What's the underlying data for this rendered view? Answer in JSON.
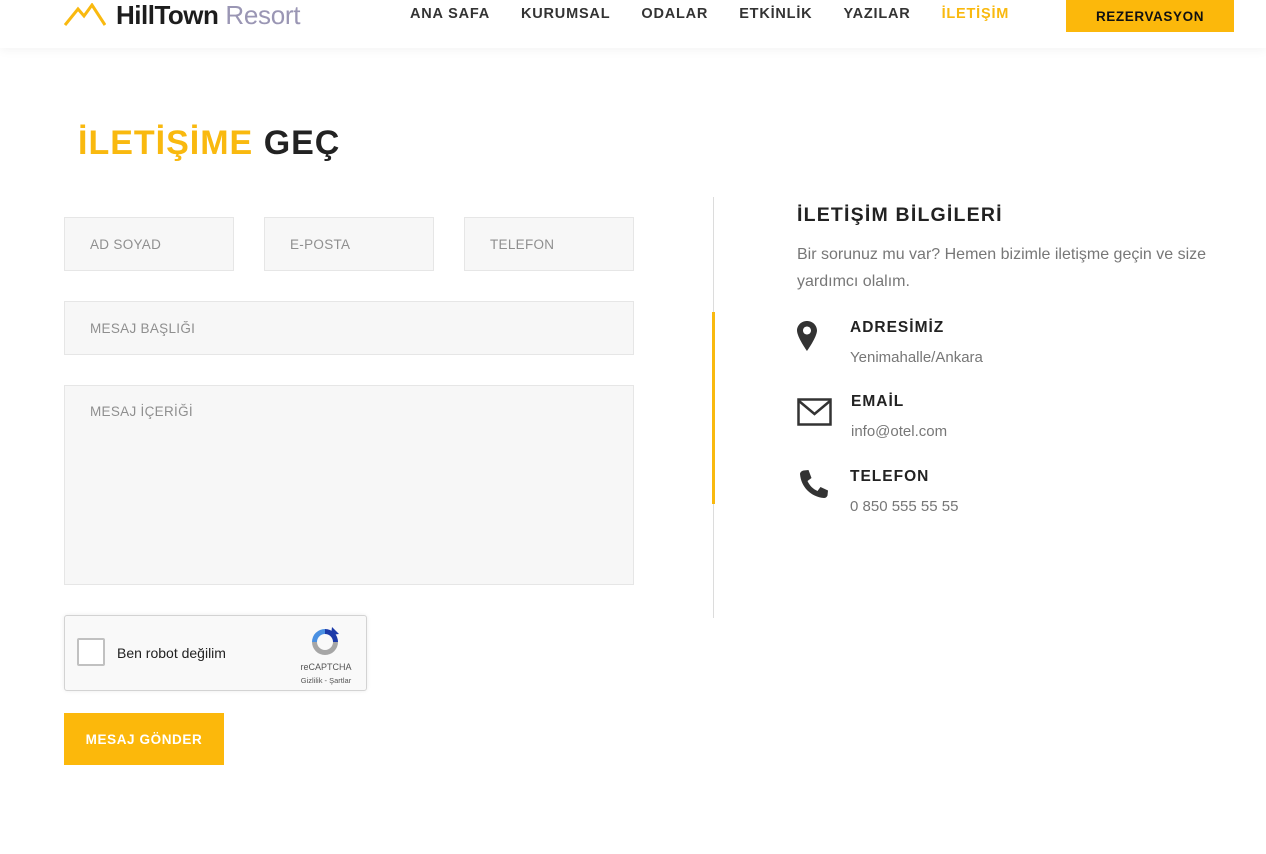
{
  "header": {
    "logo_main": "HillTown",
    "logo_sub": "Resort",
    "nav": [
      {
        "label": "ANA SAFA"
      },
      {
        "label": "KURUMSAL"
      },
      {
        "label": "ODALAR"
      },
      {
        "label": "ETKİNLİK"
      },
      {
        "label": "YAZILAR"
      },
      {
        "label": "İLETİŞİM",
        "active": true
      }
    ],
    "reserve_label": "REZERVASYON"
  },
  "page_title": {
    "highlight": "İLETİŞİME",
    "rest": "GEÇ"
  },
  "form": {
    "name_placeholder": "AD SOYAD",
    "email_placeholder": "E-POSTA",
    "phone_placeholder": "TELEFON",
    "subject_placeholder": "MESAJ BAŞLIĞI",
    "message_placeholder": "MESAJ İÇERİĞİ",
    "captcha": {
      "label": "Ben robot değilim",
      "brand": "reCAPTCHA",
      "links": "Gizlilik - Şartlar"
    },
    "submit_label": "MESAJ GÖNDER"
  },
  "contact": {
    "title": "İLETİŞİM BİLGİLERİ",
    "description": "Bir sorunuz mu var? Hemen bizimle iletişme geçin ve size yardımcı olalım.",
    "items": [
      {
        "icon": "location-pin-icon",
        "label": "ADRESİMİZ",
        "value": "Yenimahalle/Ankara"
      },
      {
        "icon": "envelope-icon",
        "label": "EMAİL",
        "value": "info@otel.com"
      },
      {
        "icon": "phone-icon",
        "label": "TELEFON",
        "value": "0 850 555 55 55"
      }
    ]
  },
  "colors": {
    "accent": "#f9b90f",
    "text_dark": "#222222",
    "text_muted": "#777777",
    "logo_sub": "#9a96b4"
  }
}
